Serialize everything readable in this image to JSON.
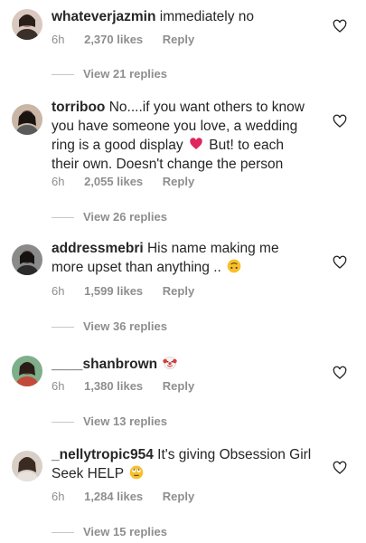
{
  "comments": [
    {
      "username": "whateverjazmin",
      "text": "immediately no",
      "emoji": "",
      "text_after": "",
      "time": "6h",
      "likes": "2,370 likes",
      "reply": "Reply",
      "replies": "View 21 replies"
    },
    {
      "username": "torriboo",
      "text": "No....if you want others to know you have someone you love, a wedding ring is a good display",
      "emoji": "red-heart-emoji",
      "text_after": "But! to each their own. Doesn't change the person",
      "time": "6h",
      "likes": "2,055 likes",
      "reply": "Reply",
      "replies": "View 26 replies"
    },
    {
      "username": "addressmebri",
      "text": "His name making me more upset than anything ..",
      "emoji": "upside-down-face-emoji",
      "text_after": "",
      "time": "6h",
      "likes": "1,599 likes",
      "reply": "Reply",
      "replies": "View 36 replies"
    },
    {
      "username": "____shanbrown",
      "text": "",
      "emoji": "clown-face-emoji",
      "text_after": "",
      "time": "6h",
      "likes": "1,380 likes",
      "reply": "Reply",
      "replies": "View 13 replies"
    },
    {
      "username": "_nellytropic954",
      "text": "It's giving Obsession Girl Seek HELP",
      "emoji": "rolling-eyes-emoji",
      "text_after": "",
      "time": "6h",
      "likes": "1,284 likes",
      "reply": "Reply",
      "replies": "View 15 replies"
    }
  ],
  "colors": {
    "meta": "#8e8e8e",
    "text": "#262626",
    "heart_emoji": "#e0245e"
  },
  "icons": {
    "like": "heart-outline-icon"
  }
}
